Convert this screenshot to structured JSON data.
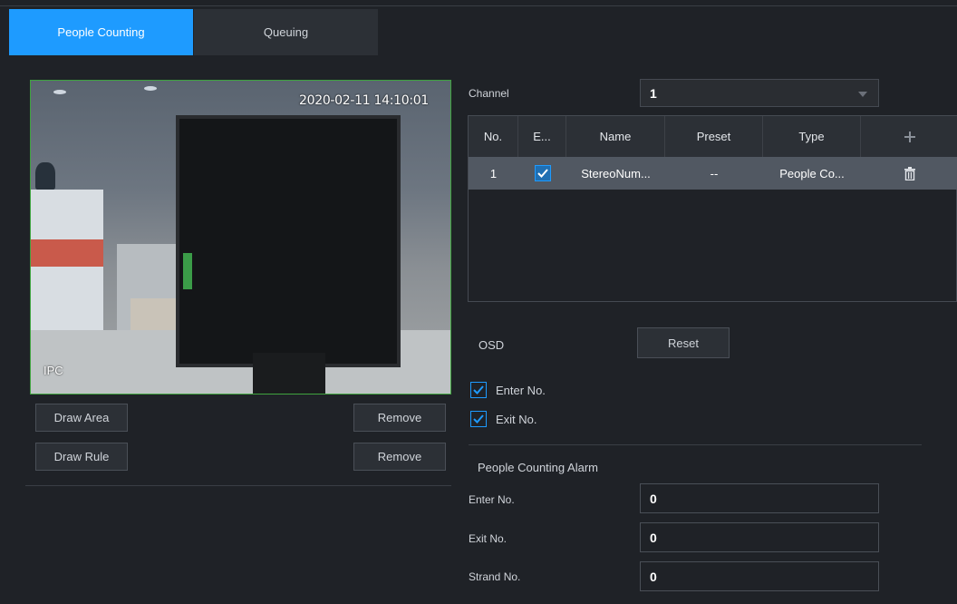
{
  "tabs": [
    {
      "label": "People Counting",
      "active": true
    },
    {
      "label": "Queuing",
      "active": false
    }
  ],
  "video": {
    "timestamp": "2020-02-11 14:10:01",
    "overlay_label": "IPC"
  },
  "controls": {
    "draw_area": "Draw Area",
    "remove_area": "Remove",
    "draw_rule": "Draw Rule",
    "remove_rule": "Remove"
  },
  "channel": {
    "label": "Channel",
    "value": "1"
  },
  "rules_table": {
    "headers": [
      "No.",
      "E...",
      "Name",
      "Preset",
      "Type",
      "+"
    ],
    "rows": [
      {
        "no": "1",
        "enabled": true,
        "name": "StereoNum...",
        "preset": "--",
        "type": "People Co..."
      }
    ]
  },
  "osd": {
    "label": "OSD",
    "reset_label": "Reset",
    "enter_no": {
      "label": "Enter No.",
      "checked": true
    },
    "exit_no": {
      "label": "Exit No.",
      "checked": true
    }
  },
  "alarm": {
    "section_title": "People Counting Alarm",
    "fields": [
      {
        "label": "Enter No.",
        "value": "0"
      },
      {
        "label": "Exit No.",
        "value": "0"
      },
      {
        "label": "Strand No.",
        "value": "0"
      }
    ]
  },
  "colors": {
    "accent": "#1e9bff",
    "background": "#1f2227",
    "selected_row": "#515862",
    "video_border": "#3fa33f"
  },
  "icons": {
    "add": "plus-icon",
    "delete": "trash-icon",
    "dropdown": "chevron-down-icon",
    "check": "checkmark-icon"
  }
}
